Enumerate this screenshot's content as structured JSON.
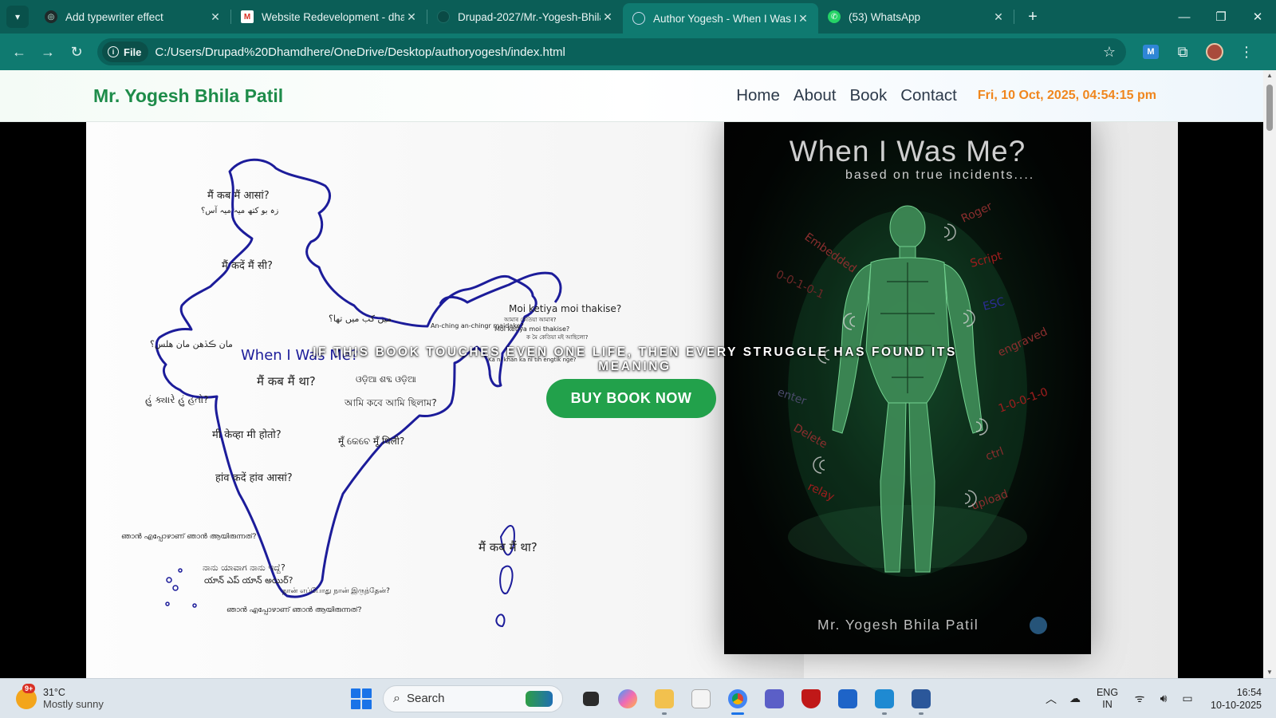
{
  "browser": {
    "tabs": [
      {
        "title": "Add typewriter effect",
        "active": false,
        "icon": "chatgpt-icon"
      },
      {
        "title": "Website Redevelopment - dhan",
        "active": false,
        "icon": "gmail-icon"
      },
      {
        "title": "Drupad-2027/Mr.-Yogesh-Bhila",
        "active": false,
        "icon": "github-icon"
      },
      {
        "title": "Author Yogesh - When I Was M",
        "active": true,
        "icon": "globe-icon"
      },
      {
        "title": "(53) WhatsApp",
        "active": false,
        "icon": "whatsapp-icon"
      }
    ],
    "chip_label": "File",
    "url": "C:/Users/Drupad%20Dhamdhere/OneDrive/Desktop/authoryogesh/index.html"
  },
  "site": {
    "brand": "Mr. Yogesh Bhila Patil",
    "nav": [
      "Home",
      "About",
      "Book",
      "Contact"
    ],
    "datetime": "Fri, 10 Oct, 2025, 04:54:15 pm",
    "tagline": "IF THIS BOOK TOUCHES EVEN ONE LIFE, THEN EVERY STRUGGLE HAS FOUND ITS MEANING",
    "buy_button": "BUY BOOK NOW",
    "colors": {
      "brand": "#1e8c4a",
      "clock": "#f0861d",
      "button": "#22a14b"
    }
  },
  "map_art": {
    "title": "When I Was Me?",
    "phrases": [
      "मैं कब मैं आसां?",
      "زہ بو کتھ میہ میہ آس؟",
      "मैं कदें मैं सी?",
      "میں کب میں تھا؟",
      "مان ڪڏهن مان هلس؟",
      "मैं कब मैं था?",
      "ଓଡ଼ିଆ ଶବ୍ଦ ଓଡ଼ିଆ",
      "હું ક્યારે હું હતો?",
      "আমি কবে আমি ছিলাম?",
      "मी केव्हा मी होतो?",
      "मूँ କେବେ मूँ थिली?",
      "हांव कदें हांव आसां?",
      "ഞാൻ എപ്പോഴാണ് ഞാൻ ആയിരുന്നത്?",
      "ನಾನು ಯಾವಾಗ ನಾನು ಇದ್ದೆ?",
      "యాన్ ఎప్ యాన్ అయిర్?",
      "நான் எப்போது நான் இருந்தேன்?",
      "ഞാൻ എപ്പോഴാണ് ഞാൻ ആയിരുന്നത്?",
      "मैं कब मैं था?",
      "Moi ketiya moi thakise?",
      "An-ching an-chingr maidake?",
      "আমাৰ কেতিয়া আমাৰ?",
      "Moi ketiya moi thakise?",
      "ক মৈ কেতিয়া মই আছিলো?",
      "Ka ni khan ka ni tih engtik nge?"
    ]
  },
  "book_cover": {
    "title": "When I Was Me?",
    "subtitle": "based on true incidents....",
    "author": "Mr. Yogesh Bhila Patil",
    "words": [
      "Embedded",
      "Roger",
      "Script",
      "0-0-1-0-1",
      "ESC",
      "engraved",
      "enter",
      "1-0-0-1-0",
      "Delete",
      "ctrl",
      "relay",
      "upload"
    ]
  },
  "taskbar": {
    "temp": "31°C",
    "weather": "Mostly sunny",
    "badge": "9+",
    "search": "Search",
    "lang1": "ENG",
    "lang2": "IN",
    "time": "16:54",
    "date": "10-10-2025"
  }
}
